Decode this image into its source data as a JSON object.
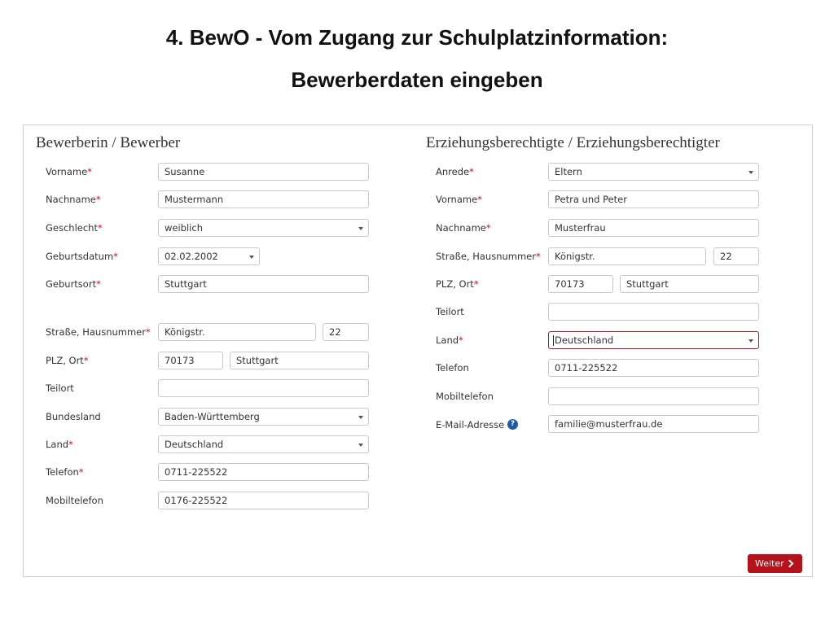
{
  "header": {
    "title_line1": "4. BewO - Vom Zugang zur Schulplatzinformation:",
    "title_line2": "Bewerberdaten eingeben"
  },
  "applicant": {
    "section_title": "Bewerberin / Bewerber",
    "fields": {
      "vorname": {
        "label": "Vorname",
        "value": "Susanne"
      },
      "nachname": {
        "label": "Nachname",
        "value": "Mustermann"
      },
      "geschlecht": {
        "label": "Geschlecht",
        "value": "weiblich"
      },
      "geburtsdatum": {
        "label": "Geburtsdatum",
        "value": "02.02.2002"
      },
      "geburtsort": {
        "label": "Geburtsort",
        "value": "Stuttgart"
      },
      "strasse": {
        "label": "Straße, Hausnummer",
        "value": "Königstr.",
        "number": "22"
      },
      "plz_ort": {
        "label": "PLZ, Ort",
        "plz": "70173",
        "ort": "Stuttgart"
      },
      "teilort": {
        "label": "Teilort",
        "value": ""
      },
      "bundesland": {
        "label": "Bundesland",
        "value": "Baden-Württemberg"
      },
      "land": {
        "label": "Land",
        "value": "Deutschland"
      },
      "telefon": {
        "label": "Telefon",
        "value": "0711-225522"
      },
      "mobiltelefon": {
        "label": "Mobiltelefon",
        "value": "0176-225522"
      }
    }
  },
  "guardian": {
    "section_title": "Erziehungsberechtigte / Erziehungsberechtigter",
    "fields": {
      "anrede": {
        "label": "Anrede",
        "value": "Eltern"
      },
      "vorname": {
        "label": "Vorname",
        "value": "Petra und Peter"
      },
      "nachname": {
        "label": "Nachname",
        "value": "Musterfrau"
      },
      "strasse": {
        "label": "Straße, Hausnummer",
        "value": "Königstr.",
        "number": "22"
      },
      "plz_ort": {
        "label": "PLZ, Ort",
        "plz": "70173",
        "ort": "Stuttgart"
      },
      "teilort": {
        "label": "Teilort",
        "value": ""
      },
      "land": {
        "label": "Land",
        "value": "Deutschland"
      },
      "telefon": {
        "label": "Telefon",
        "value": "0711-225522"
      },
      "mobiltelefon": {
        "label": "Mobiltelefon",
        "value": ""
      },
      "email": {
        "label": "E-Mail-Adresse",
        "value": "familie@musterfrau.de"
      }
    }
  },
  "required_marker": "*",
  "help_icon": {
    "name": "question-icon",
    "glyph": "?"
  },
  "actions": {
    "next_label": "Weiter",
    "next_icon": "chevron-right-icon"
  },
  "colors": {
    "accent": "#b5121b",
    "help": "#1f5aa6"
  }
}
